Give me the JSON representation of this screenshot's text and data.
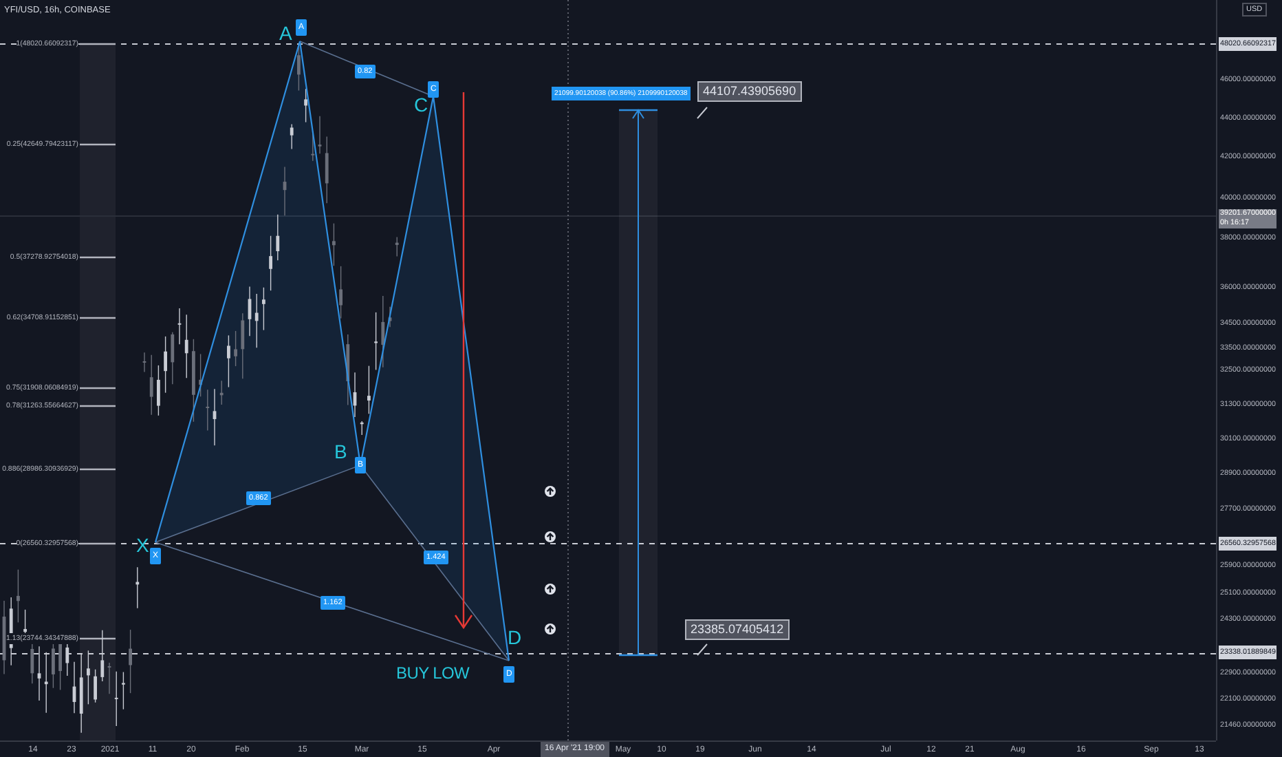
{
  "header": {
    "symbol": "YFI/USD, 16h, COINBASE"
  },
  "fib_levels": [
    {
      "label": "1(48020.66092317)"
    },
    {
      "label": "0.25(42649.79423117)"
    },
    {
      "label": "0.5(37278.92754018)"
    },
    {
      "label": "0.62(34708.91152851)"
    },
    {
      "label": "0.75(31908.06084919)"
    },
    {
      "label": "0.78(31263.55664627)"
    },
    {
      "label": "0.886(28986.30936929)"
    },
    {
      "label": "0(26560.32957568)"
    },
    {
      "label": "1.13(23744.34347888)"
    }
  ],
  "pattern": {
    "points": [
      {
        "letter": "X",
        "tag": "X"
      },
      {
        "letter": "A",
        "tag": "A"
      },
      {
        "letter": "B",
        "tag": "B"
      },
      {
        "letter": "C",
        "tag": "C"
      },
      {
        "letter": "D",
        "tag": "D"
      }
    ],
    "ratios": [
      "0.82",
      "0.862",
      "1.424",
      "1.162"
    ],
    "note": "BUY LOW"
  },
  "measure": {
    "label": "21099.90120038 (90.86%) 2109990120038",
    "high": "44107.43905690",
    "low": "23385.07405412"
  },
  "price_axis": {
    "currency": "USD",
    "items": [
      {
        "kind": "mark",
        "text": "48020.66092317"
      },
      {
        "kind": "tick",
        "text": "46000.00000000"
      },
      {
        "kind": "tick",
        "text": "44000.00000000"
      },
      {
        "kind": "tick",
        "text": "42000.00000000"
      },
      {
        "kind": "tick",
        "text": "40000.00000000"
      },
      {
        "kind": "current",
        "text": "39201.67000000",
        "countdown": "0h 16:17"
      },
      {
        "kind": "tick",
        "text": "38000.00000000"
      },
      {
        "kind": "tick",
        "text": "36000.00000000"
      },
      {
        "kind": "tick",
        "text": "34500.00000000"
      },
      {
        "kind": "tick",
        "text": "33500.00000000"
      },
      {
        "kind": "tick",
        "text": "32500.00000000"
      },
      {
        "kind": "tick",
        "text": "31300.00000000"
      },
      {
        "kind": "tick",
        "text": "30100.00000000"
      },
      {
        "kind": "tick",
        "text": "28900.00000000"
      },
      {
        "kind": "tick",
        "text": "27700.00000000"
      },
      {
        "kind": "mark",
        "text": "26560.32957568"
      },
      {
        "kind": "tick",
        "text": "25900.00000000"
      },
      {
        "kind": "tick",
        "text": "25100.00000000"
      },
      {
        "kind": "tick",
        "text": "24300.00000000"
      },
      {
        "kind": "mark",
        "text": "23338.01889849"
      },
      {
        "kind": "tick",
        "text": "22900.00000000"
      },
      {
        "kind": "tick",
        "text": "22100.00000000"
      },
      {
        "kind": "tick",
        "text": "21460.00000000"
      }
    ]
  },
  "time_axis": {
    "ticks": [
      "14",
      "23",
      "2021",
      "11",
      "20",
      "Feb",
      "15",
      "Mar",
      "15",
      "Apr",
      "May",
      "10",
      "19",
      "Jun",
      "14",
      "Jul",
      "12",
      "21",
      "Aug",
      "16",
      "Sep",
      "13"
    ],
    "cursor": "16 Apr '21  19:00"
  }
}
